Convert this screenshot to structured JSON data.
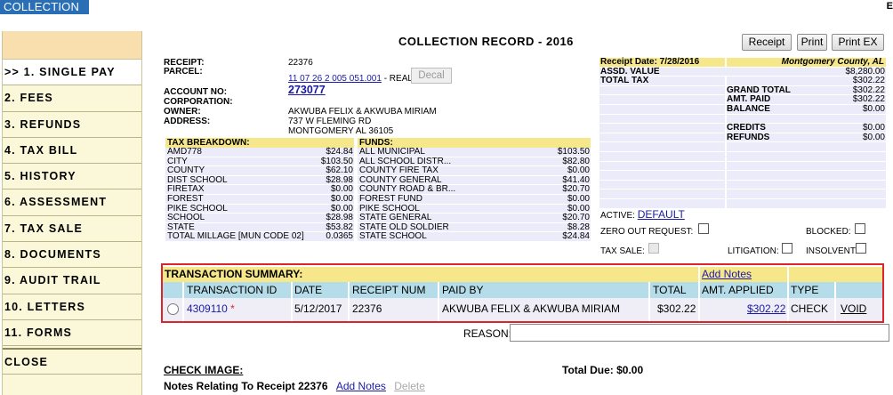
{
  "app": {
    "tab_label": "COLLECTION",
    "edge_char": "E"
  },
  "sidebar": {
    "items": [
      {
        "label": ">> 1. SINGLE PAY",
        "active": true
      },
      {
        "label": "2. FEES"
      },
      {
        "label": "3. REFUNDS"
      },
      {
        "label": "4. TAX BILL"
      },
      {
        "label": "5. HISTORY"
      },
      {
        "label": "6. ASSESSMENT"
      },
      {
        "label": "7. TAX SALE"
      },
      {
        "label": "8. DOCUMENTS"
      },
      {
        "label": "9. AUDIT TRAIL"
      },
      {
        "label": "10. LETTERS"
      },
      {
        "label": "11. FORMS"
      }
    ],
    "close_label": "CLOSE"
  },
  "record": {
    "title": "COLLECTION RECORD - 2016",
    "buttons": {
      "receipt": "Receipt",
      "print": "Print",
      "print_ex": "Print EX"
    },
    "receipt_label": "RECEIPT:",
    "receipt_value": "22376",
    "parcel_label": "PARCEL:",
    "parcel_value": "11 07 26 2 005 051.001",
    "parcel_suffix": "- REAL",
    "decal_label": "Decal",
    "account_label": "ACCOUNT NO:",
    "account_value": "273077",
    "corporation_label": "CORPORATION:",
    "owner_label": "OWNER:",
    "owner_value": "AKWUBA FELIX & AKWUBA MIRIAM",
    "address_label": "ADDRESS:",
    "address_line1": "737 W FLEMING RD",
    "address_line2": "MONTGOMERY AL  36105"
  },
  "tax_breakdown": {
    "header": "TAX BREAKDOWN:",
    "rows": [
      {
        "name": "AMD778",
        "amount": "$24.84"
      },
      {
        "name": "CITY",
        "amount": "$103.50"
      },
      {
        "name": "COUNTY",
        "amount": "$62.10"
      },
      {
        "name": "DIST SCHOOL",
        "amount": "$28.98"
      },
      {
        "name": "FIRETAX",
        "amount": "$0.00"
      },
      {
        "name": "FOREST",
        "amount": "$0.00"
      },
      {
        "name": "PIKE SCHOOL",
        "amount": "$0.00"
      },
      {
        "name": "SCHOOL",
        "amount": "$28.98"
      },
      {
        "name": "STATE",
        "amount": "$53.82"
      },
      {
        "name": "TOTAL MILLAGE [MUN CODE 02]",
        "amount": "0.0365"
      }
    ]
  },
  "funds": {
    "header": "FUNDS:",
    "rows": [
      {
        "name": "ALL MUNICIPAL",
        "amount": "$103.50"
      },
      {
        "name": "ALL SCHOOL DISTR...",
        "amount": "$82.80"
      },
      {
        "name": "COUNTY FIRE TAX",
        "amount": "$0.00"
      },
      {
        "name": "COUNTY GENERAL",
        "amount": "$41.40"
      },
      {
        "name": "COUNTY ROAD & BR...",
        "amount": "$20.70"
      },
      {
        "name": "FOREST FUND",
        "amount": "$0.00"
      },
      {
        "name": "PIKE SCHOOL",
        "amount": "$0.00"
      },
      {
        "name": "STATE GENERAL",
        "amount": "$20.70"
      },
      {
        "name": "STATE OLD SOLDIER",
        "amount": "$8.28"
      },
      {
        "name": "STATE SCHOOL",
        "amount": "$24.84"
      }
    ]
  },
  "summary": {
    "receipt_date": "Receipt Date: 7/28/2016",
    "county": "Montgomery County, AL",
    "assd_label": "ASSD. VALUE",
    "assd_value": "$8,280.00",
    "total_tax_label": "TOTAL TAX",
    "total_tax_value": "$302.22",
    "grand_total_label": "GRAND TOTAL",
    "grand_total_value": "$302.22",
    "amt_paid_label": "AMT. PAID",
    "amt_paid_value": "$302.22",
    "balance_label": "BALANCE",
    "balance_value": "$0.00",
    "credits_label": "CREDITS",
    "credits_value": "$0.00",
    "refunds_label": "REFUNDS",
    "refunds_value": "$0.00",
    "active_label": "ACTIVE:",
    "active_value": "DEFAULT",
    "zero_out_label": "ZERO OUT REQUEST:",
    "blocked_label": "BLOCKED:",
    "tax_sale_label": "TAX SALE:",
    "litigation_label": "LITIGATION:",
    "insolvent_label": "INSOLVENT:"
  },
  "transactions": {
    "title": "TRANSACTION SUMMARY:",
    "add_notes": "Add Notes",
    "columns": [
      "TRANSACTION ID",
      "DATE",
      "RECEIPT NUM",
      "PAID BY",
      "TOTAL",
      "AMT. APPLIED",
      "TYPE"
    ],
    "row": {
      "id": "4309110",
      "marker": "*",
      "date": "5/12/2017",
      "receipt_num": "22376",
      "paid_by": "AKWUBA FELIX & AKWUBA MIRIAM",
      "total": "$302.22",
      "amt_applied": "$302.22",
      "type": "CHECK",
      "void": "VOID"
    }
  },
  "footer": {
    "reason_label": "REASON:",
    "check_image": "CHECK IMAGE:",
    "total_due": "Total Due: $0.00",
    "notes_label": "Notes Relating To Receipt 22376",
    "add_notes": "Add Notes",
    "delete": "Delete"
  }
}
